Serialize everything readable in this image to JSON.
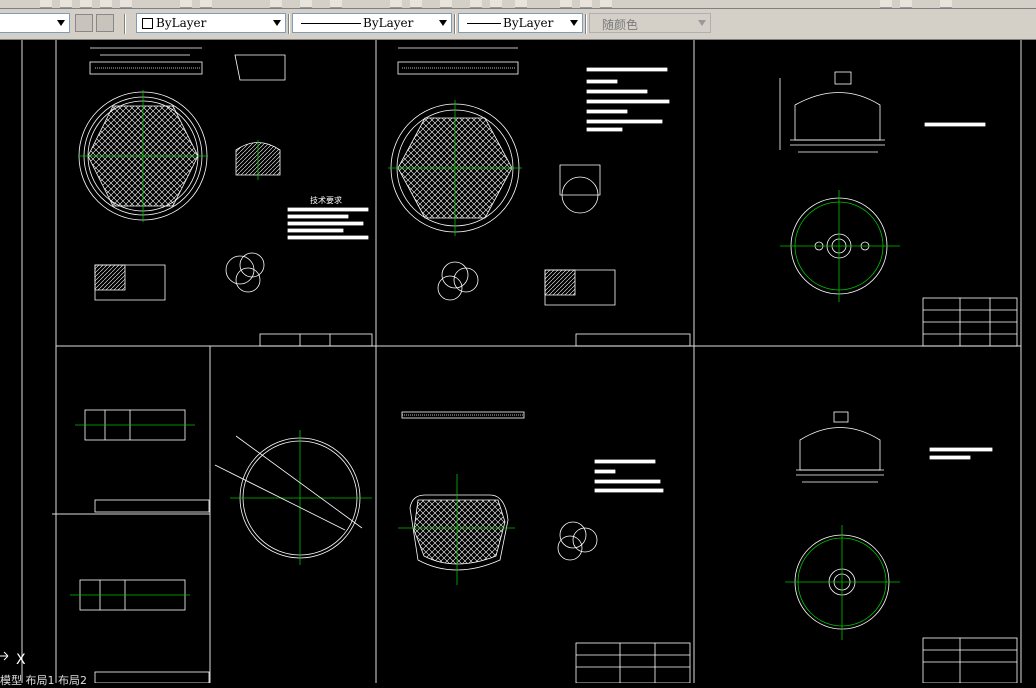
{
  "properties_bar": {
    "color_combo": "ByLayer",
    "linetype_combo": "ByLayer",
    "lineweight_combo": "ByLayer",
    "plotstyle_combo": "随颜色"
  },
  "drawing": {
    "tech_requirements_title": "技术要求",
    "ucs_label": "X",
    "command_line_text": "模型 布局1 布局2"
  }
}
